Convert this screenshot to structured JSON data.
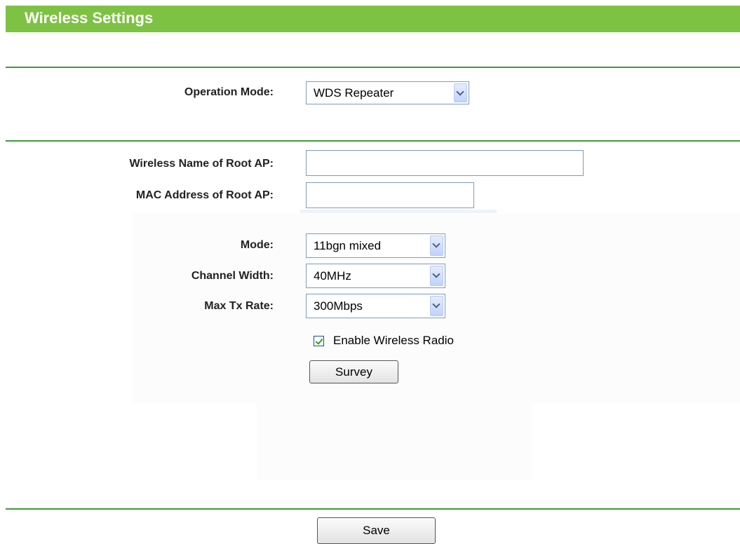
{
  "header": {
    "title": "Wireless Settings"
  },
  "operation_mode": {
    "label": "Operation Mode:",
    "value": "WDS Repeater"
  },
  "root_ap": {
    "ssid_label": "Wireless Name of Root AP:",
    "ssid_value": "",
    "mac_label": "MAC Address of Root AP:",
    "mac_value": ""
  },
  "radio": {
    "mode_label": "Mode:",
    "mode_value": "11bgn mixed",
    "channel_width_label": "Channel Width:",
    "channel_width_value": "40MHz",
    "max_tx_rate_label": "Max Tx Rate:",
    "max_tx_rate_value": "300Mbps",
    "enable_radio_label": "Enable Wireless Radio",
    "enable_radio_checked": true
  },
  "buttons": {
    "survey": "Survey",
    "save": "Save"
  },
  "colors": {
    "header_bg": "#7dc242",
    "divider": "#3d9b35"
  }
}
